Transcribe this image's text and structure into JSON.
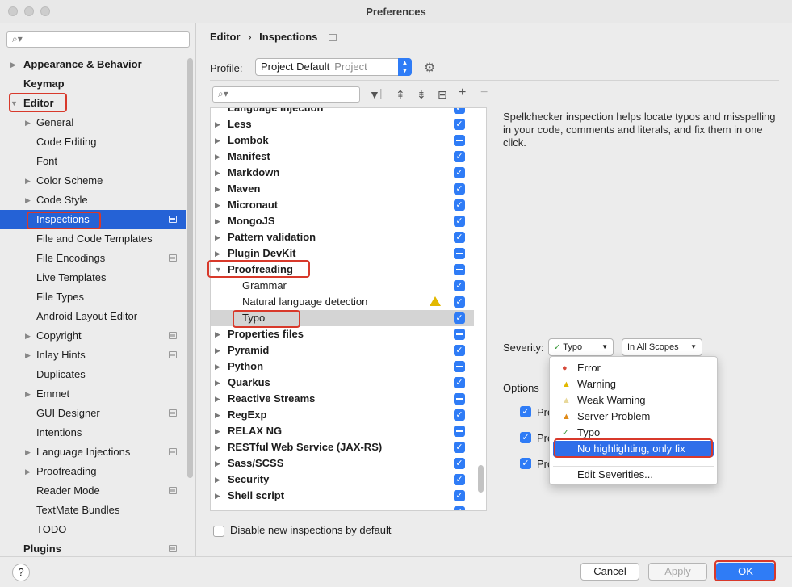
{
  "window": {
    "title": "Preferences"
  },
  "sidebar": {
    "items": [
      {
        "label": "Appearance & Behavior",
        "bold": true,
        "arrow": "right",
        "indent": 0
      },
      {
        "label": "Keymap",
        "bold": true,
        "indent": 0
      },
      {
        "label": "Editor",
        "bold": true,
        "arrow": "down",
        "indent": 0
      },
      {
        "label": "General",
        "arrow": "right",
        "indent": 1
      },
      {
        "label": "Code Editing",
        "indent": 1
      },
      {
        "label": "Font",
        "indent": 1
      },
      {
        "label": "Color Scheme",
        "arrow": "right",
        "indent": 1
      },
      {
        "label": "Code Style",
        "arrow": "right",
        "indent": 1
      },
      {
        "label": "Inspections",
        "indent": 1,
        "selected": true,
        "project": true
      },
      {
        "label": "File and Code Templates",
        "indent": 1
      },
      {
        "label": "File Encodings",
        "indent": 1,
        "project": true
      },
      {
        "label": "Live Templates",
        "indent": 1
      },
      {
        "label": "File Types",
        "indent": 1
      },
      {
        "label": "Android Layout Editor",
        "indent": 1
      },
      {
        "label": "Copyright",
        "arrow": "right",
        "indent": 1,
        "project": true
      },
      {
        "label": "Inlay Hints",
        "arrow": "right",
        "indent": 1,
        "project": true
      },
      {
        "label": "Duplicates",
        "indent": 1
      },
      {
        "label": "Emmet",
        "arrow": "right",
        "indent": 1
      },
      {
        "label": "GUI Designer",
        "indent": 1,
        "project": true
      },
      {
        "label": "Intentions",
        "indent": 1
      },
      {
        "label": "Language Injections",
        "arrow": "right",
        "indent": 1,
        "project": true
      },
      {
        "label": "Proofreading",
        "arrow": "right",
        "indent": 1
      },
      {
        "label": "Reader Mode",
        "indent": 1,
        "project": true
      },
      {
        "label": "TextMate Bundles",
        "indent": 1
      },
      {
        "label": "TODO",
        "indent": 1
      },
      {
        "label": "Plugins",
        "bold": true,
        "indent": 0,
        "project": true
      }
    ]
  },
  "header": {
    "breadcrumb": [
      "Editor",
      "Inspections"
    ],
    "profile_label": "Profile:",
    "profile_value": "Project Default",
    "profile_scope": "Project"
  },
  "tree": {
    "clipped_top": "Language Injection",
    "items": [
      {
        "label": "Less",
        "bold": true,
        "arrow": "right",
        "check": "checked"
      },
      {
        "label": "Lombok",
        "bold": true,
        "arrow": "right",
        "check": "partial"
      },
      {
        "label": "Manifest",
        "bold": true,
        "arrow": "right",
        "check": "checked"
      },
      {
        "label": "Markdown",
        "bold": true,
        "arrow": "right",
        "check": "checked"
      },
      {
        "label": "Maven",
        "bold": true,
        "arrow": "right",
        "check": "checked"
      },
      {
        "label": "Micronaut",
        "bold": true,
        "arrow": "right",
        "check": "checked"
      },
      {
        "label": "MongoJS",
        "bold": true,
        "arrow": "right",
        "check": "checked"
      },
      {
        "label": "Pattern validation",
        "bold": true,
        "arrow": "right",
        "check": "checked"
      },
      {
        "label": "Plugin DevKit",
        "bold": true,
        "arrow": "right",
        "check": "partial"
      },
      {
        "label": "Proofreading",
        "bold": true,
        "arrow": "down",
        "check": "partial"
      },
      {
        "label": "Grammar",
        "child": true,
        "check": "checked"
      },
      {
        "label": "Natural language detection",
        "child": true,
        "check": "checked",
        "warn": true
      },
      {
        "label": "Typo",
        "child": true,
        "check": "checked",
        "highlight": true
      },
      {
        "label": "Properties files",
        "bold": true,
        "arrow": "right",
        "check": "partial"
      },
      {
        "label": "Pyramid",
        "bold": true,
        "arrow": "right",
        "check": "checked"
      },
      {
        "label": "Python",
        "bold": true,
        "arrow": "right",
        "check": "partial"
      },
      {
        "label": "Quarkus",
        "bold": true,
        "arrow": "right",
        "check": "checked"
      },
      {
        "label": "Reactive Streams",
        "bold": true,
        "arrow": "right",
        "check": "partial"
      },
      {
        "label": "RegExp",
        "bold": true,
        "arrow": "right",
        "check": "checked"
      },
      {
        "label": "RELAX NG",
        "bold": true,
        "arrow": "right",
        "check": "partial"
      },
      {
        "label": "RESTful Web Service (JAX-RS)",
        "bold": true,
        "arrow": "right",
        "check": "checked"
      },
      {
        "label": "Sass/SCSS",
        "bold": true,
        "arrow": "right",
        "check": "checked"
      },
      {
        "label": "Security",
        "bold": true,
        "arrow": "right",
        "check": "checked"
      },
      {
        "label": "Shell script",
        "bold": true,
        "arrow": "right",
        "check": "checked"
      }
    ],
    "disable_new_label": "Disable new inspections by default"
  },
  "details": {
    "description": "Spellchecker inspection helps locate typos and misspelling in your code, comments and literals, and fix them in one click.",
    "severity_label": "Severity:",
    "severity_value": "Typo",
    "scope_value": "In All Scopes",
    "options_label": "Options",
    "option_texts": [
      "Pro",
      "Pro",
      "Pro"
    ]
  },
  "severity_dropdown": {
    "items": [
      {
        "label": "Error",
        "icon": "error-icon"
      },
      {
        "label": "Warning",
        "icon": "warning-icon"
      },
      {
        "label": "Weak Warning",
        "icon": "weak-warning-icon"
      },
      {
        "label": "Server Problem",
        "icon": "server-problem-icon"
      },
      {
        "label": "Typo",
        "icon": "typo-icon"
      },
      {
        "label": "No highlighting, only fix",
        "selected": true
      }
    ],
    "edit_label": "Edit Severities..."
  },
  "footer": {
    "help_label": "?",
    "cancel_label": "Cancel",
    "apply_label": "Apply",
    "ok_label": "OK"
  },
  "colors": {
    "accent": "#2f7cf6",
    "selection": "#2562d6",
    "annotation": "#d8392b"
  }
}
